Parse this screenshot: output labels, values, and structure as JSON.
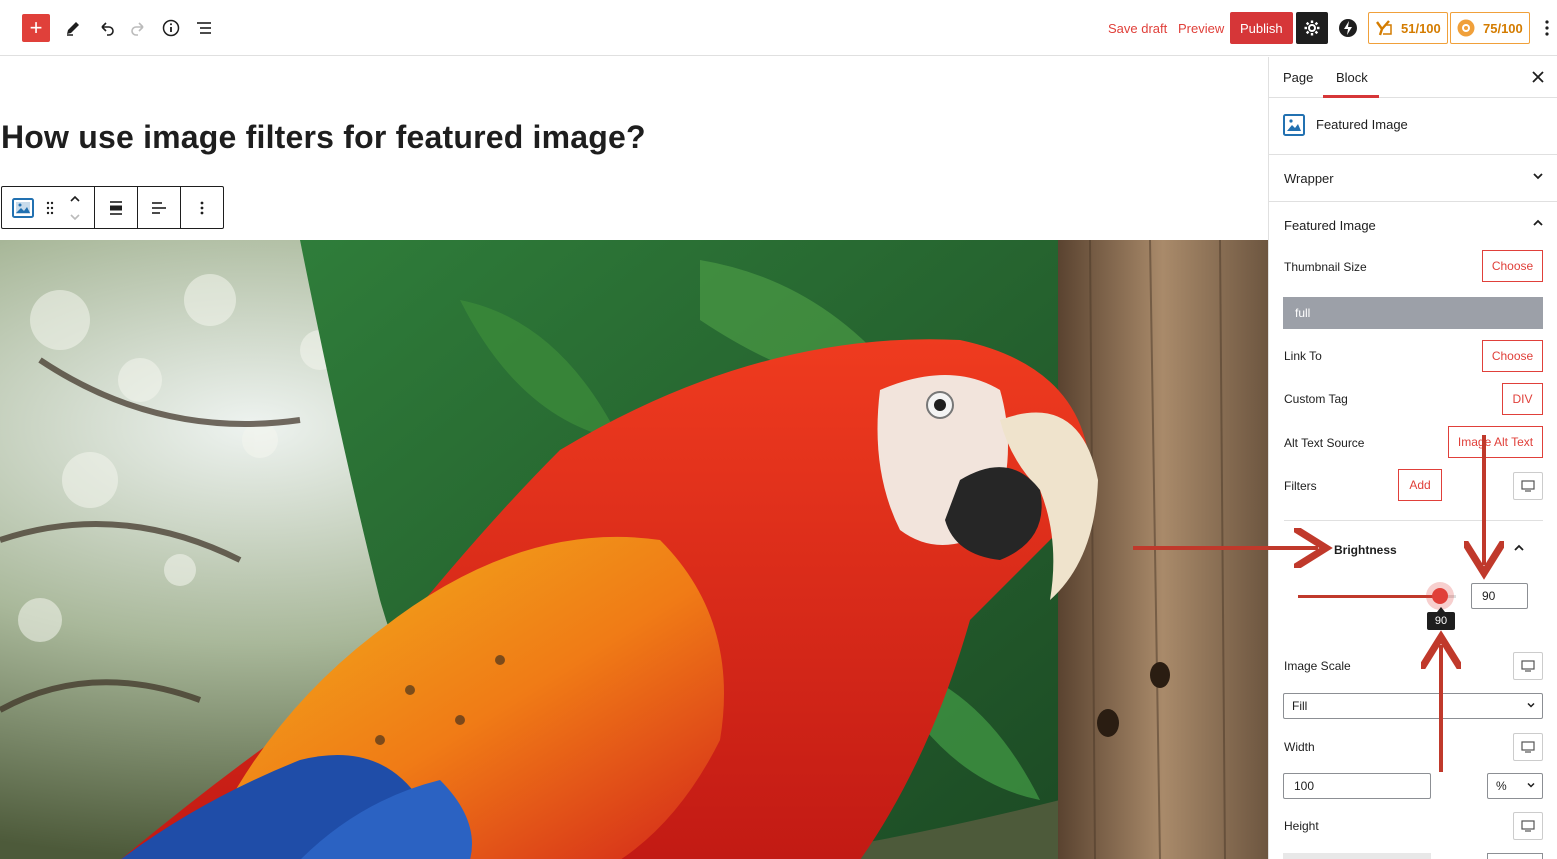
{
  "topbar": {
    "save_draft": "Save draft",
    "preview": "Preview",
    "publish": "Publish",
    "score_seo": "51/100",
    "score_readability": "75/100"
  },
  "editor": {
    "title": "How use image filters for featured image?"
  },
  "sidebar": {
    "tabs": [
      "Page",
      "Block"
    ],
    "active_tab": "Block",
    "block_name": "Featured Image",
    "panels": {
      "wrapper": "Wrapper",
      "featured_image": "Featured Image"
    },
    "thumbnail_size": {
      "label": "Thumbnail Size",
      "button": "Choose",
      "value": "full"
    },
    "link_to": {
      "label": "Link To",
      "button": "Choose"
    },
    "custom_tag": {
      "label": "Custom Tag",
      "value": "DIV"
    },
    "alt_text_source": {
      "label": "Alt Text Source",
      "value": "Image Alt Text"
    },
    "filters": {
      "label": "Filters",
      "button": "Add"
    },
    "brightness": {
      "label": "Brightness",
      "value": "90",
      "tooltip": "90",
      "level": 0.9
    },
    "image_scale": {
      "label": "Image Scale",
      "value": "Fill"
    },
    "width": {
      "label": "Width",
      "value": "100",
      "unit": "%"
    },
    "height": {
      "label": "Height"
    }
  },
  "colors": {
    "accent": "#e0403a",
    "publish": "#d63638",
    "score": "#d47c00",
    "annotation_arrow": "#c0392b"
  }
}
